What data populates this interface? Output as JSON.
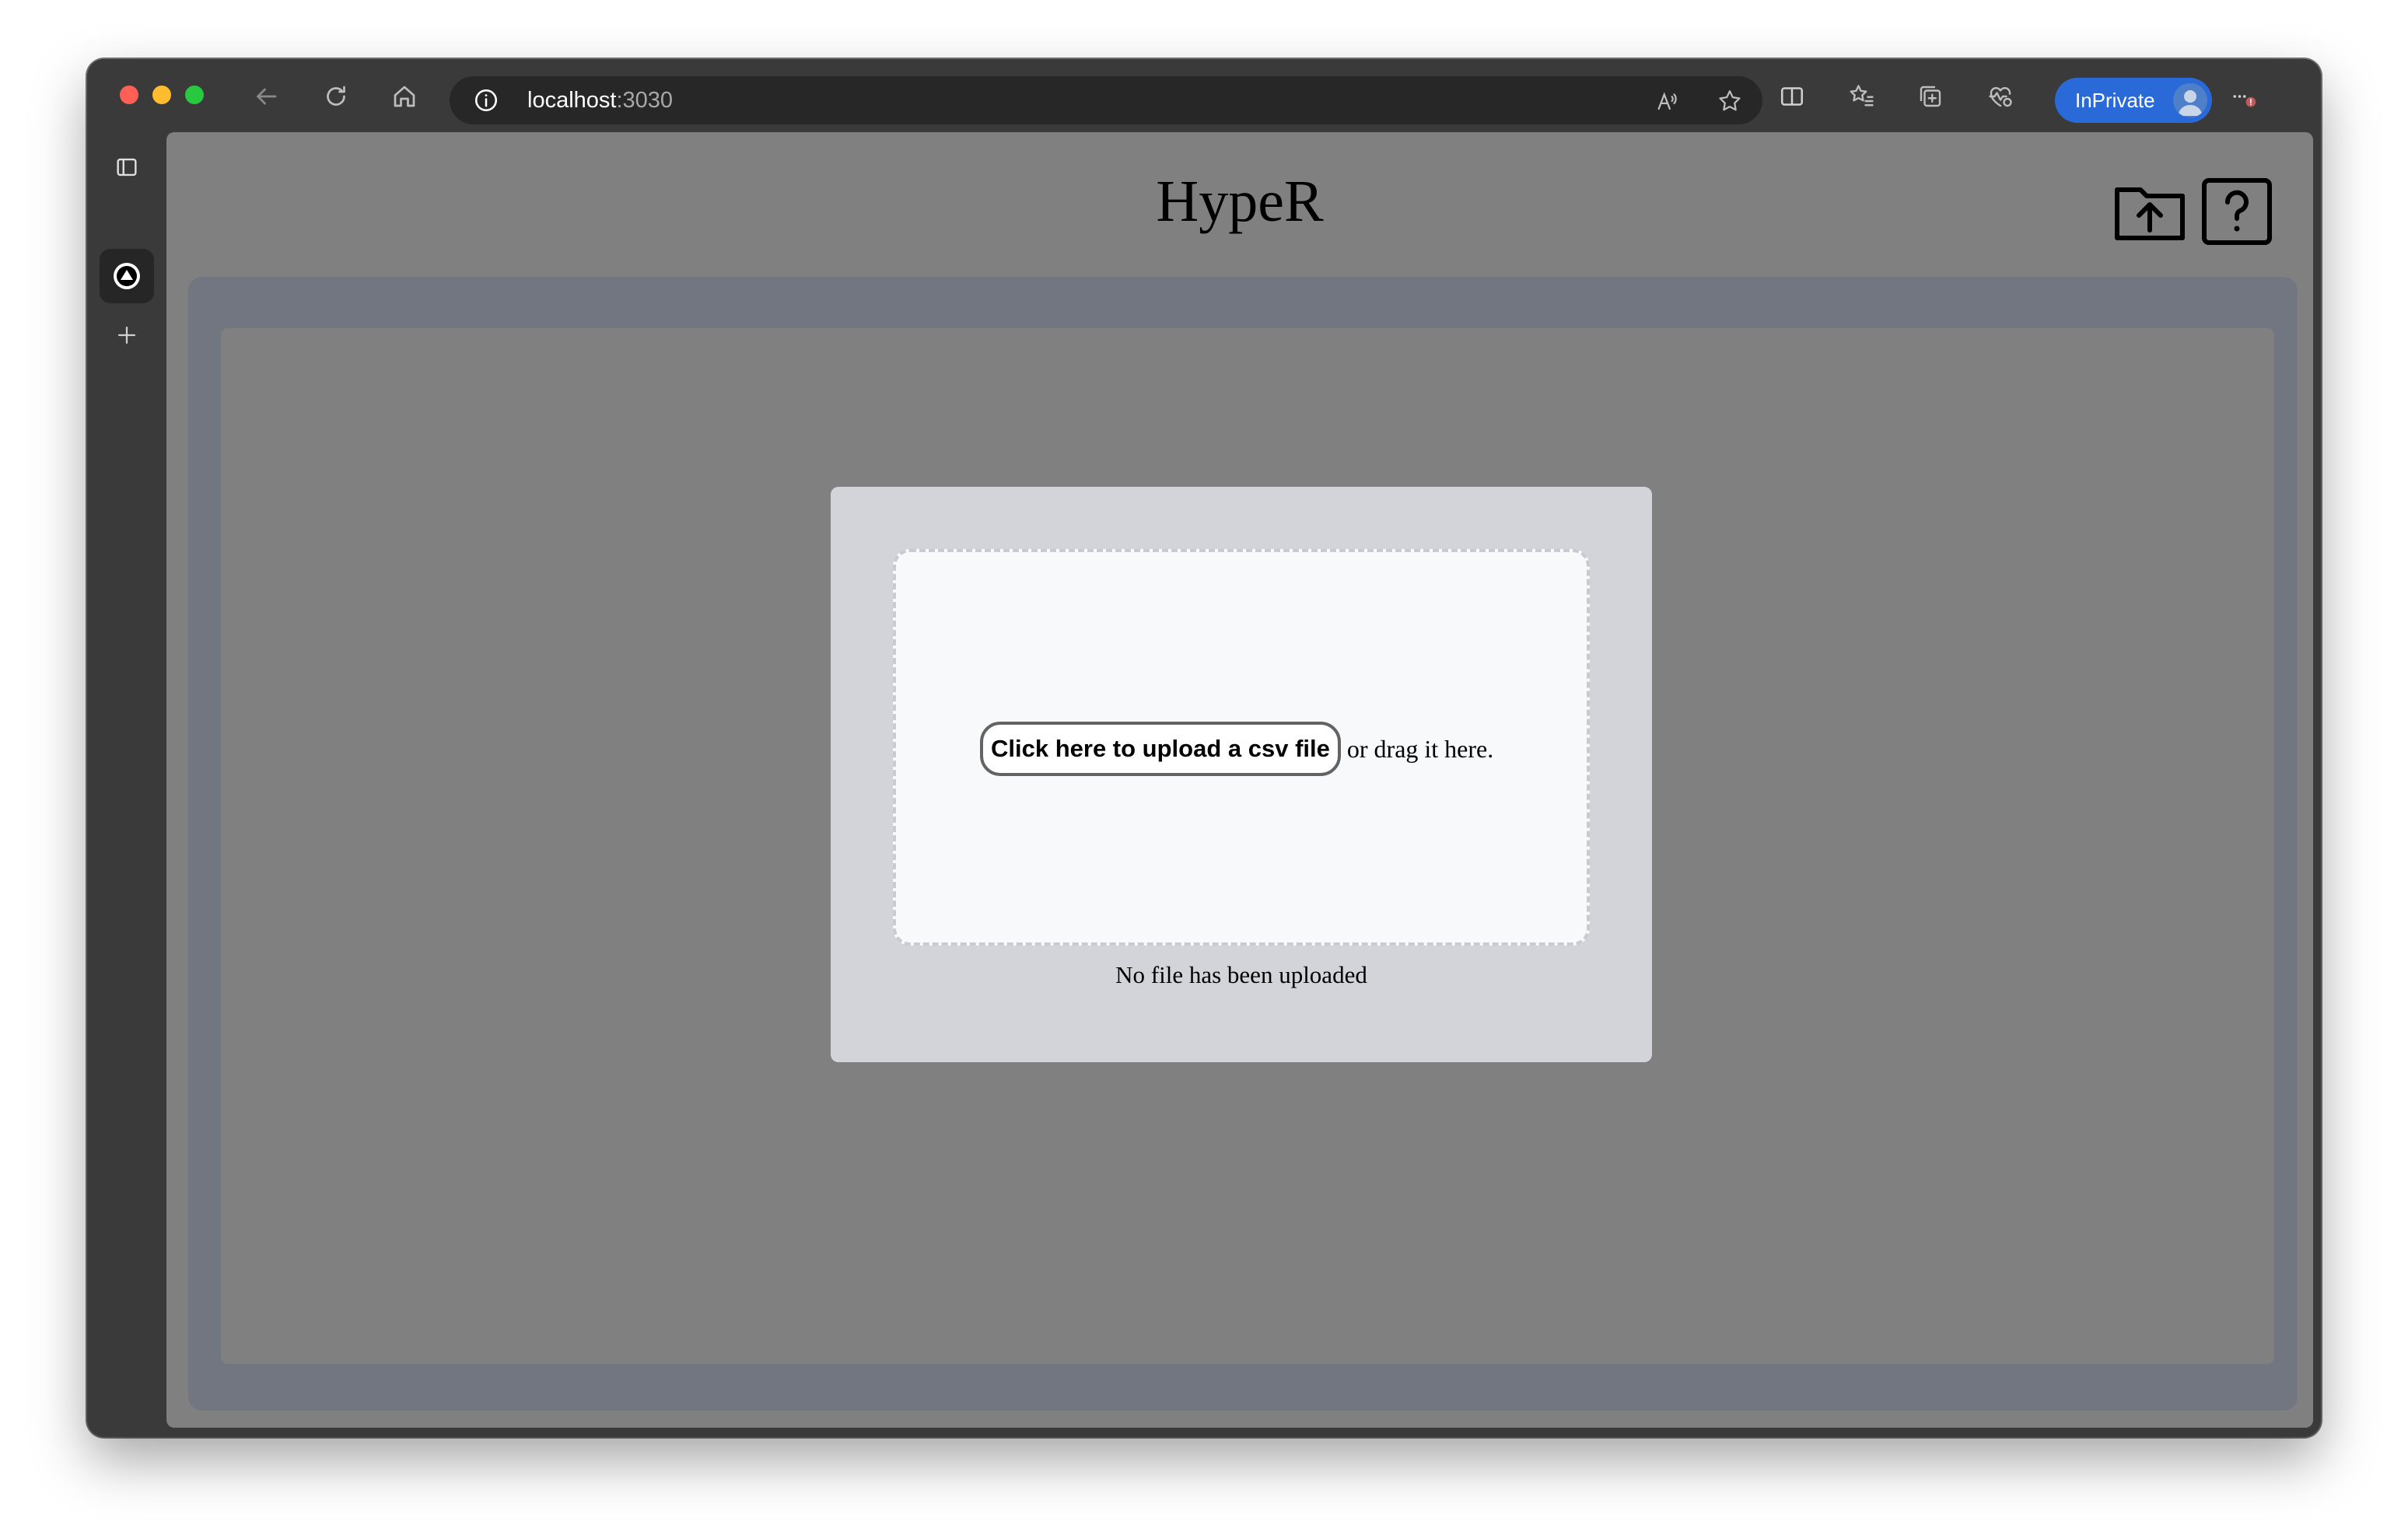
{
  "browser": {
    "address": {
      "host": "localhost",
      "port": ":3030"
    },
    "inprivate_label": "InPrivate",
    "icons": {
      "back": "back-arrow-icon",
      "refresh": "refresh-icon",
      "home": "home-icon",
      "site_info": "info-icon",
      "read_aloud": "read-aloud-icon",
      "favorite": "star-icon",
      "split_screen": "split-screen-icon",
      "favorites": "favorites-icon",
      "collections": "collections-icon",
      "browser_essentials": "heart-pulse-icon",
      "more": "more-icon"
    }
  },
  "sidebar": {
    "icons": [
      "tab-actions-icon",
      "tab-favicon",
      "new-tab-icon"
    ]
  },
  "app": {
    "title": "HypeR",
    "icons": {
      "upload": "folder-upload-icon",
      "help": "help-icon"
    },
    "upload": {
      "button_label": "Click here to upload a csv file",
      "hint": "or drag it here.",
      "status": "No file has been uploaded"
    }
  },
  "colors": {
    "page_background": "#808080",
    "panel": "#717680",
    "card": "#d2d4da",
    "dropzone": "#f8f9fa",
    "inprivate_accent": "#2a6ad8"
  }
}
